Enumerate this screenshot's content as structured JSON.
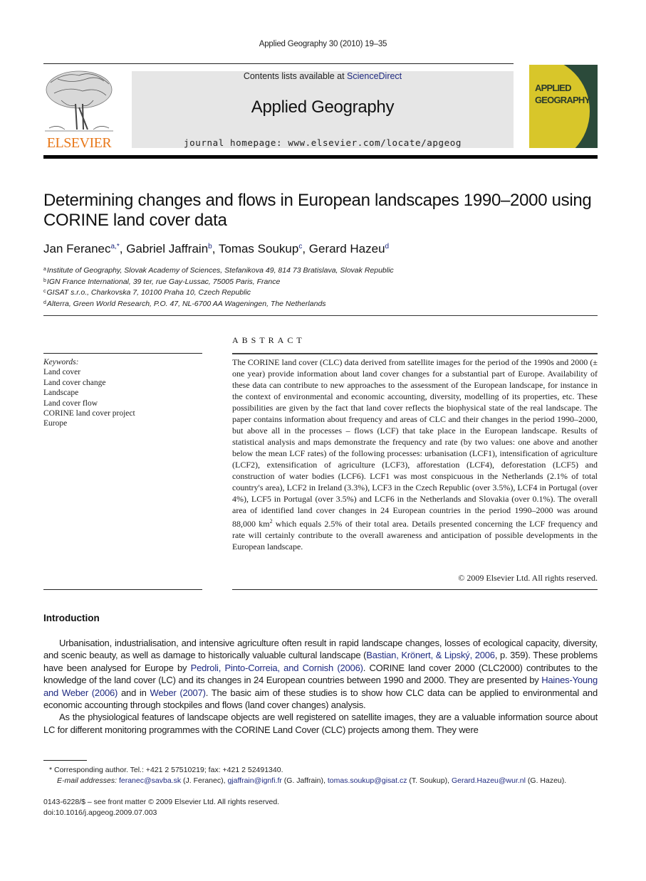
{
  "header": {
    "journal_ref": "Applied Geography 30 (2010) 19–35",
    "publisher_logo_text": "ELSEVIER",
    "contents_prefix": "Contents lists available at ",
    "contents_link": "ScienceDirect",
    "journal_title": "Applied Geography",
    "homepage": "journal homepage: www.elsevier.com/locate/apgeog",
    "cover_title_line1": "Applied",
    "cover_title_line2": "Geography"
  },
  "article": {
    "title": "Determining changes and flows in European landscapes 1990–2000 using CORINE land cover data",
    "authors": [
      {
        "name": "Jan Feranec",
        "sup": "a,*"
      },
      {
        "name": "Gabriel Jaffrain",
        "sup": "b"
      },
      {
        "name": "Tomas Soukup",
        "sup": "c"
      },
      {
        "name": "Gerard Hazeu",
        "sup": "d"
      }
    ],
    "affiliations": [
      {
        "sup": "a",
        "text": "Institute of Geography, Slovak Academy of Sciences, Stefanikova 49, 814 73 Bratislava, Slovak Republic"
      },
      {
        "sup": "b",
        "text": "IGN France International, 39 ter, rue Gay-Lussac, 75005 Paris, France"
      },
      {
        "sup": "c",
        "text": "GISAT s.r.o., Charkovska 7, 10100 Praha 10, Czech Republic"
      },
      {
        "sup": "d",
        "text": "Alterra, Green World Research, P.O. 47, NL-6700 AA Wageningen, The Netherlands"
      }
    ]
  },
  "keywords": {
    "label": "Keywords:",
    "items": [
      "Land cover",
      "Land cover change",
      "Landscape",
      "Land cover flow",
      "CORINE land cover project",
      "Europe"
    ]
  },
  "abstract": {
    "heading": "ABSTRACT",
    "text_part1": "The CORINE land cover (CLC) data derived from satellite images for the period of the 1990s and 2000 (± one year) provide information about land cover changes for a substantial part of Europe. Availability of these data can contribute to new approaches to the assessment of the European landscape, for instance in the context of environmental and economic accounting, diversity, modelling of its properties, etc. These possibilities are given by the fact that land cover reflects the biophysical state of the real landscape. The paper contains information about frequency and areas of CLC and their changes in the period 1990–2000, but above all in the processes – flows (LCF) that take place in the European landscape. Results of statistical analysis and maps demonstrate the frequency and rate (by two values: one above and another below the mean LCF rates) of the following processes: urbanisation (LCF1), intensification of agriculture (LCF2), extensification of agriculture (LCF3), afforestation (LCF4), deforestation (LCF5) and construction of water bodies (LCF6). LCF1 was most conspicuous in the Netherlands (2.1% of total country's area), LCF2 in Ireland (3.3%), LCF3 in the Czech Republic (over 3.5%), LCF4 in Portugal (over 4%), LCF5 in Portugal (over 3.5%) and LCF6 in the Netherlands and Slovakia (over 0.1%). The overall area of identified land cover changes in 24 European countries in the period 1990–2000 was around 88,000 km",
    "text_sup": "2",
    "text_part2": " which equals 2.5% of their total area. Details presented concerning the LCF frequency and rate will certainly contribute to the overall awareness and anticipation of possible developments in the European landscape.",
    "copyright": "© 2009 Elsevier Ltd. All rights reserved."
  },
  "introduction": {
    "heading": "Introduction",
    "p1_a": "Urbanisation, industrialisation, and intensive agriculture often result in rapid landscape changes, losses of ecological capacity, diversity, and scenic beauty, as well as damage to historically valuable cultural landscape (",
    "p1_link1": "Bastian, Krönert, & Lipský, 2006",
    "p1_b": ", p. 359). These problems have been analysed for Europe by ",
    "p1_link2": "Pedroli, Pinto-Correia, and Cornish (2006)",
    "p1_c": ". CORINE land cover 2000 (CLC2000) contributes to the knowledge of the land cover (LC) and its changes in 24 European countries between 1990 and 2000. They are presented by ",
    "p1_link3": "Haines-Young and Weber (2006)",
    "p1_d": " and in ",
    "p1_link4": "Weber (2007)",
    "p1_e": ". The basic aim of these studies is to show how CLC data can be applied to environmental and economic accounting through stockpiles and flows (land cover changes) analysis.",
    "p2": "As the physiological features of landscape objects are well registered on satellite images, they are a valuable information source about LC for different monitoring programmes with the CORINE Land Cover (CLC) projects among them. They were"
  },
  "footnotes": {
    "corresponding": "* Corresponding author. Tel.: +421 2 57510219; fax: +421 2 52491340.",
    "email_label": "E-mail addresses:",
    "emails": [
      {
        "address": "feranec@savba.sk",
        "owner": " (J. Feranec), "
      },
      {
        "address": "gjaffrain@ignfi.fr",
        "owner": " (G. Jaffrain), "
      },
      {
        "address": "tomas.soukup@gisat.cz",
        "owner": " (T. Soukup), "
      },
      {
        "address": "Gerard.Hazeu@wur.nl",
        "owner": " (G. Hazeu)."
      }
    ],
    "issn": "0143-6228/$ – see front matter © 2009 Elsevier Ltd. All rights reserved.",
    "doi": "doi:10.1016/j.apgeog.2009.07.003"
  }
}
